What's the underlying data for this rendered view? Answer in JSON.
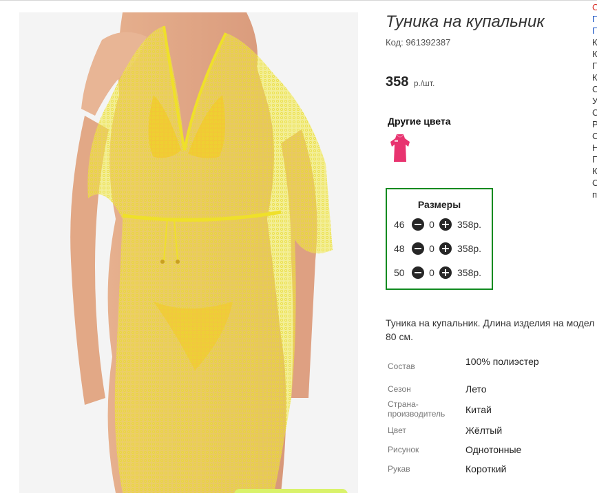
{
  "product": {
    "title": "Туника на купальник",
    "sku": "Код: 961392387",
    "price": "358",
    "price_unit": "р./шт."
  },
  "other_colors": {
    "title": "Другие цвета",
    "swatch_color": "#e8336f"
  },
  "sizes": {
    "title": "Размеры",
    "rows": [
      {
        "size": "46",
        "qty": "0",
        "price": "358р."
      },
      {
        "size": "48",
        "qty": "0",
        "price": "358р."
      },
      {
        "size": "50",
        "qty": "0",
        "price": "358р."
      }
    ]
  },
  "description": "Туника на купальник. Длина изделия на модел 80 см.",
  "attributes": [
    {
      "label": "Состав",
      "value": "100% полиэстер"
    },
    {
      "label": "Сезон",
      "value": "Лето"
    },
    {
      "label": "Страна-производитель",
      "value": "Китай"
    },
    {
      "label": "Цвет",
      "value": "Жёлтый"
    },
    {
      "label": "Рисунок",
      "value": "Однотонные"
    },
    {
      "label": "Рукав",
      "value": "Короткий"
    }
  ],
  "side_menu": [
    "С",
    "П",
    "П",
    "К",
    "К",
    "П",
    "К",
    "С",
    "У",
    "С",
    "Р",
    "С",
    "Н",
    "П",
    "К",
    "С",
    "п"
  ],
  "colors": {
    "accent_green": "#108a1f",
    "tunic_yellow": "#f3ea4a",
    "bikini_orange": "#f2a11e"
  }
}
